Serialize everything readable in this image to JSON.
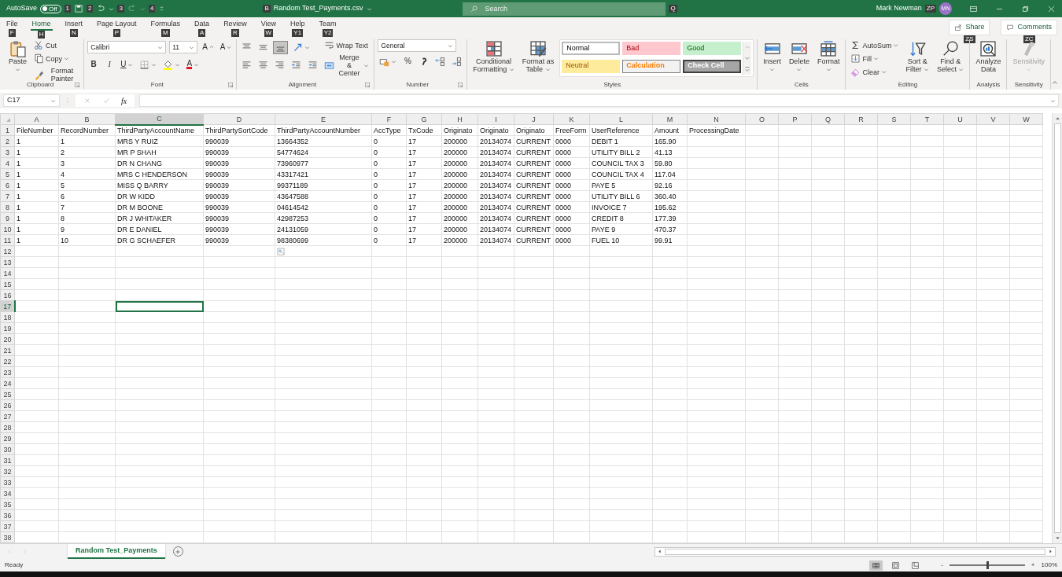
{
  "title_bar": {
    "autosave_label": "AutoSave",
    "autosave": {
      "label": "Off",
      "on": false
    },
    "keytips": [
      "1",
      "2",
      "3",
      "4"
    ],
    "file_keytip": "B",
    "file_name": "Random Test_Payments.csv",
    "search": {
      "placeholder": "Search",
      "keytip": "Q"
    },
    "user_name": "Mark Newman",
    "user_keytip": "ZP",
    "avatar": "MN"
  },
  "ribbon_tabs": [
    {
      "label": "File",
      "keytip": "F",
      "selected": false
    },
    {
      "label": "Home",
      "keytip": "H",
      "selected": true
    },
    {
      "label": "Insert",
      "keytip": "N",
      "selected": false
    },
    {
      "label": "Page Layout",
      "keytip": "P",
      "selected": false
    },
    {
      "label": "Formulas",
      "keytip": "M",
      "selected": false
    },
    {
      "label": "Data",
      "keytip": "A",
      "selected": false
    },
    {
      "label": "Review",
      "keytip": "R",
      "selected": false
    },
    {
      "label": "View",
      "keytip": "W",
      "selected": false
    },
    {
      "label": "Help",
      "keytip": "Y1",
      "selected": false
    },
    {
      "label": "Team",
      "keytip": "Y2",
      "selected": false
    }
  ],
  "share_button": {
    "label": "Share",
    "keytip": "ZS"
  },
  "comments_button": {
    "label": "Comments",
    "keytip": "ZC"
  },
  "ribbon_groups": [
    {
      "label": "Clipboard",
      "launcher": true,
      "disabled": false,
      "columns": [
        [
          {
            "kind": "big",
            "lines": [
              "Paste"
            ],
            "caret": true
          }
        ],
        [
          {
            "kind": "small",
            "label": "Cut",
            "caret": false
          },
          {
            "kind": "small",
            "label": "Copy",
            "caret": true
          },
          {
            "kind": "small",
            "label": "Format Painter",
            "caret": false
          }
        ]
      ]
    },
    {
      "label": "Font",
      "launcher": true,
      "disabled": false,
      "columns": [
        [
          {
            "kind": "row",
            "items": [
              {
                "kind": "select",
                "value": "Calibri"
              },
              {
                "kind": "select",
                "value": "11"
              },
              {
                "kind": "glyph_icon",
                "label": "A"
              },
              {
                "kind": "glyph_icon",
                "label": "A"
              }
            ]
          },
          {
            "kind": "row",
            "items": [
              {
                "kind": "bold_glyph",
                "label": "B",
                "caret": false
              },
              {
                "kind": "italic_glyph",
                "label": "I",
                "caret": false
              },
              {
                "kind": "underline_glyph",
                "label": "U",
                "caret": true
              },
              {
                "kind": "icon",
                "caret": true,
                "pressed": false
              },
              {
                "kind": "icon",
                "caret": true,
                "pressed": false
              },
              {
                "kind": "color_glyph",
                "label": "A",
                "color": "#e81123",
                "caret": true
              }
            ]
          }
        ]
      ]
    },
    {
      "label": "Alignment",
      "launcher": true,
      "disabled": false,
      "columns": [
        [
          {
            "kind": "row",
            "items": [
              {
                "kind": "icon",
                "caret": false,
                "pressed": false
              },
              {
                "kind": "icon",
                "caret": false,
                "pressed": false
              },
              {
                "kind": "icon",
                "caret": false,
                "pressed": true
              },
              {
                "kind": "icon",
                "caret": true,
                "pressed": false
              }
            ]
          },
          {
            "kind": "row",
            "items": [
              {
                "kind": "icon",
                "caret": false,
                "pressed": false
              },
              {
                "kind": "icon",
                "caret": false,
                "pressed": false
              },
              {
                "kind": "icon",
                "caret": false,
                "pressed": false
              },
              {
                "kind": "icon",
                "caret": false,
                "pressed": false
              },
              {
                "kind": "icon",
                "caret": false,
                "pressed": false
              }
            ]
          }
        ],
        [
          {
            "kind": "small",
            "label": "Wrap Text",
            "caret": false
          },
          {
            "kind": "small",
            "label": "Merge & Center",
            "caret": true
          }
        ]
      ]
    },
    {
      "label": "Number",
      "launcher": true,
      "disabled": false,
      "columns": [
        [
          {
            "kind": "select",
            "value": "General"
          },
          {
            "kind": "row",
            "items": [
              {
                "kind": "icon",
                "caret": true,
                "pressed": false
              },
              {
                "kind": "glyph",
                "label": "%",
                "caret": false
              },
              {
                "kind": "icon",
                "caret": false,
                "pressed": false
              },
              {
                "kind": "icon",
                "caret": false,
                "pressed": false
              },
              {
                "kind": "icon",
                "caret": false,
                "pressed": false
              }
            ]
          }
        ]
      ]
    },
    {
      "label": "Styles",
      "launcher": false,
      "disabled": false,
      "columns": [
        [
          {
            "kind": "big",
            "lines": [
              "Conditional",
              "Formatting"
            ],
            "caret": true
          }
        ],
        [
          {
            "kind": "big",
            "lines": [
              "Format as",
              "Table"
            ],
            "caret": true
          }
        ],
        [
          {
            "kind": "gallery",
            "tiles": [
              {
                "label": "Normal",
                "kind": "normal"
              },
              {
                "label": "Bad",
                "kind": "bad"
              },
              {
                "label": "Good",
                "kind": "good"
              },
              {
                "label": "Neutral",
                "kind": "neutral"
              },
              {
                "label": "Calculation",
                "kind": "calculation"
              },
              {
                "label": "Check Cell",
                "kind": "check"
              }
            ]
          }
        ]
      ]
    },
    {
      "label": "Cells",
      "launcher": false,
      "disabled": false,
      "columns": [
        [
          {
            "kind": "big",
            "lines": [
              "Insert"
            ],
            "caret": true
          }
        ],
        [
          {
            "kind": "big",
            "lines": [
              "Delete"
            ],
            "caret": true
          }
        ],
        [
          {
            "kind": "big",
            "lines": [
              "Format"
            ],
            "caret": true
          }
        ]
      ]
    },
    {
      "label": "Editing",
      "launcher": false,
      "disabled": false,
      "columns": [
        [
          {
            "kind": "small",
            "label": "AutoSum",
            "caret": true
          },
          {
            "kind": "small",
            "label": "Fill",
            "caret": true
          },
          {
            "kind": "small",
            "label": "Clear",
            "caret": true
          }
        ],
        [
          {
            "kind": "big",
            "lines": [
              "Sort &",
              "Filter"
            ],
            "caret": true
          }
        ],
        [
          {
            "kind": "big",
            "lines": [
              "Find &",
              "Select"
            ],
            "caret": true
          }
        ]
      ]
    },
    {
      "label": "Analysis",
      "launcher": false,
      "disabled": false,
      "columns": [
        [
          {
            "kind": "big",
            "lines": [
              "Analyze",
              "Data"
            ],
            "caret": false
          }
        ]
      ]
    },
    {
      "label": "Sensitivity",
      "launcher": false,
      "disabled": true,
      "columns": [
        [
          {
            "kind": "big",
            "lines": [
              "Sensitivity"
            ],
            "caret": true
          }
        ]
      ]
    }
  ],
  "formula_bar": {
    "name_box": "C17",
    "function_label": "fx"
  },
  "sheet": {
    "columns": [
      {
        "label": "A",
        "selected": false
      },
      {
        "label": "B",
        "selected": false
      },
      {
        "label": "C",
        "selected": true
      },
      {
        "label": "D",
        "selected": false
      },
      {
        "label": "E",
        "selected": false
      },
      {
        "label": "F",
        "selected": false
      },
      {
        "label": "G",
        "selected": false
      },
      {
        "label": "H",
        "selected": false
      },
      {
        "label": "I",
        "selected": false
      },
      {
        "label": "J",
        "selected": false
      },
      {
        "label": "K",
        "selected": false
      },
      {
        "label": "L",
        "selected": false
      },
      {
        "label": "M",
        "selected": false
      },
      {
        "label": "N",
        "selected": false
      },
      {
        "label": "O",
        "selected": false
      },
      {
        "label": "P",
        "selected": false
      },
      {
        "label": "Q",
        "selected": false
      },
      {
        "label": "R",
        "selected": false
      },
      {
        "label": "S",
        "selected": false
      },
      {
        "label": "T",
        "selected": false
      },
      {
        "label": "U",
        "selected": false
      },
      {
        "label": "V",
        "selected": false
      },
      {
        "label": "W",
        "selected": false
      }
    ],
    "rows": [
      {
        "number": "1",
        "selected": false,
        "cells": [
          "FileNumber",
          "RecordNumber",
          "ThirdPartyAccountName",
          "ThirdPartySortCode",
          "ThirdPartyAccountNumber",
          "AccType",
          "TxCode",
          "Originato",
          "Originato",
          "Originato",
          "FreeForm",
          "UserReference",
          "Amount",
          "ProcessingDate"
        ]
      },
      {
        "number": "2",
        "selected": false,
        "cells": [
          "1",
          "1",
          "MRS Y RUIZ",
          "990039",
          "13664352",
          "0",
          "17",
          "200000",
          "20134074",
          "CURRENT",
          "0000",
          "DEBIT 1",
          "165.90"
        ]
      },
      {
        "number": "3",
        "selected": false,
        "cells": [
          "1",
          "2",
          "MR P SHAH",
          "990039",
          "54774624",
          "0",
          "17",
          "200000",
          "20134074",
          "CURRENT",
          "0000",
          "UTILITY BILL 2",
          "41.13"
        ]
      },
      {
        "number": "4",
        "selected": false,
        "cells": [
          "1",
          "3",
          "DR N CHANG",
          "990039",
          "73960977",
          "0",
          "17",
          "200000",
          "20134074",
          "CURRENT",
          "0000",
          "COUNCIL TAX 3",
          "59.80"
        ]
      },
      {
        "number": "5",
        "selected": false,
        "cells": [
          "1",
          "4",
          "MRS C HENDERSON",
          "990039",
          "43317421",
          "0",
          "17",
          "200000",
          "20134074",
          "CURRENT",
          "0000",
          "COUNCIL TAX 4",
          "117.04"
        ]
      },
      {
        "number": "6",
        "selected": false,
        "cells": [
          "1",
          "5",
          "MISS Q BARRY",
          "990039",
          "99371189",
          "0",
          "17",
          "200000",
          "20134074",
          "CURRENT",
          "0000",
          "PAYE 5",
          "92.16"
        ]
      },
      {
        "number": "7",
        "selected": false,
        "cells": [
          "1",
          "6",
          "DR W KIDD",
          "990039",
          "43647588",
          "0",
          "17",
          "200000",
          "20134074",
          "CURRENT",
          "0000",
          "UTILITY BILL 6",
          "360.40"
        ]
      },
      {
        "number": "8",
        "selected": false,
        "cells": [
          "1",
          "7",
          "DR M BOONE",
          "990039",
          "04614542",
          "0",
          "17",
          "200000",
          "20134074",
          "CURRENT",
          "0000",
          "INVOICE 7",
          "195.62"
        ]
      },
      {
        "number": "9",
        "selected": false,
        "cells": [
          "1",
          "8",
          "DR J WHITAKER",
          "990039",
          "42987253",
          "0",
          "17",
          "200000",
          "20134074",
          "CURRENT",
          "0000",
          "CREDIT 8",
          "177.39"
        ]
      },
      {
        "number": "10",
        "selected": false,
        "cells": [
          "1",
          "9",
          "DR E DANIEL",
          "990039",
          "24131059",
          "0",
          "17",
          "200000",
          "20134074",
          "CURRENT",
          "0000",
          "PAYE 9",
          "470.37"
        ]
      },
      {
        "number": "11",
        "selected": false,
        "cells": [
          "1",
          "10",
          "DR G SCHAEFER",
          "990039",
          "98380699",
          "0",
          "17",
          "200000",
          "20134074",
          "CURRENT",
          "0000",
          "FUEL 10",
          "99.91"
        ]
      },
      {
        "number": "12",
        "selected": false
      },
      {
        "number": "13",
        "selected": false
      },
      {
        "number": "14",
        "selected": false
      },
      {
        "number": "15",
        "selected": false
      },
      {
        "number": "16",
        "selected": false
      },
      {
        "number": "17",
        "selected": true
      },
      {
        "number": "18",
        "selected": false
      },
      {
        "number": "19",
        "selected": false
      },
      {
        "number": "20",
        "selected": false
      },
      {
        "number": "21",
        "selected": false
      },
      {
        "number": "22",
        "selected": false
      },
      {
        "number": "23",
        "selected": false
      },
      {
        "number": "24",
        "selected": false
      },
      {
        "number": "25",
        "selected": false
      },
      {
        "number": "26",
        "selected": false
      },
      {
        "number": "27",
        "selected": false
      },
      {
        "number": "28",
        "selected": false
      },
      {
        "number": "29",
        "selected": false
      },
      {
        "number": "30",
        "selected": false
      },
      {
        "number": "31",
        "selected": false
      },
      {
        "number": "32",
        "selected": false
      },
      {
        "number": "33",
        "selected": false
      },
      {
        "number": "34",
        "selected": false
      },
      {
        "number": "35",
        "selected": false
      },
      {
        "number": "36",
        "selected": false
      },
      {
        "number": "37",
        "selected": false
      },
      {
        "number": "38",
        "selected": false
      }
    ]
  },
  "sheet_tabs": [
    {
      "label": "Random Test_Payments",
      "selected": true
    }
  ],
  "status_bar": {
    "text": "Ready",
    "views": [
      {
        "selected": true
      },
      {
        "selected": false
      },
      {
        "selected": false
      }
    ],
    "zoom": {
      "minus": "-",
      "plus": "+",
      "level": 0.5,
      "reading": "100%"
    }
  }
}
